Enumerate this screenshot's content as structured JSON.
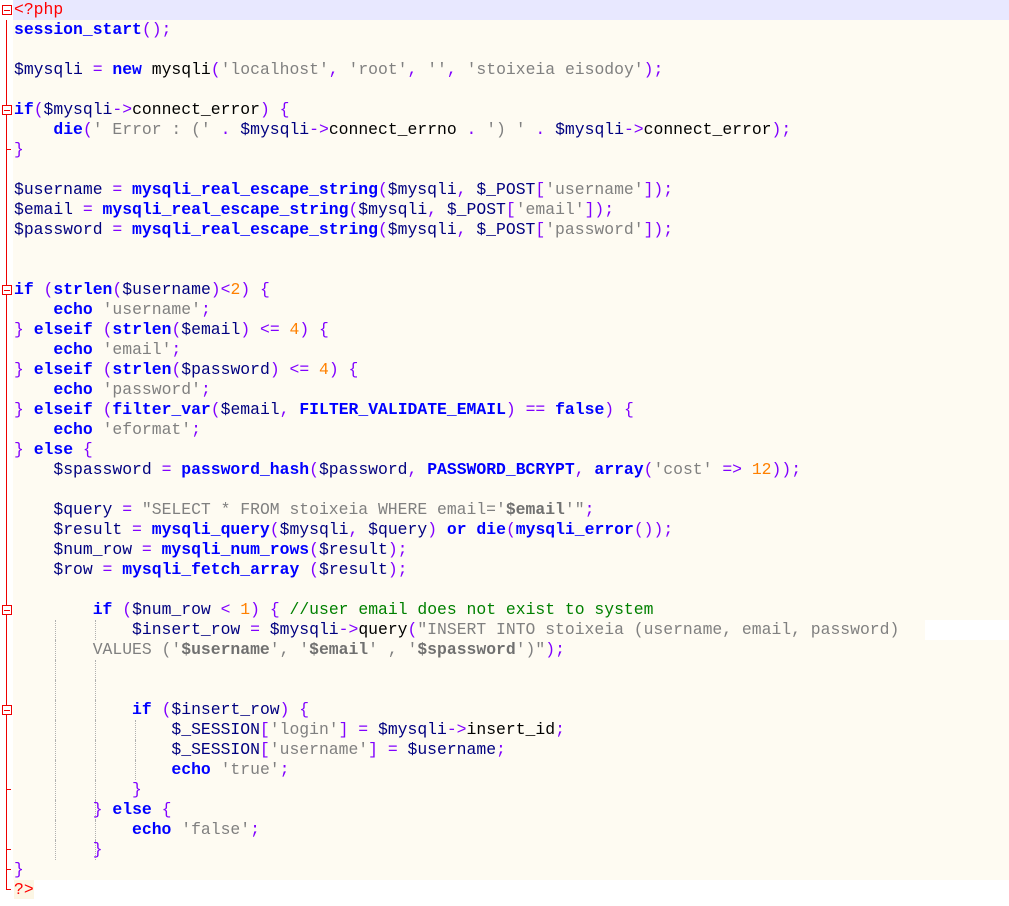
{
  "lines": [
    [
      [
        "p",
        "<?php"
      ]
    ],
    [
      [
        "k",
        "session_start"
      ],
      [
        "o",
        "();"
      ]
    ],
    [],
    [
      [
        "v",
        "$mysqli"
      ],
      [
        "o",
        " = "
      ],
      [
        "k",
        "new"
      ],
      [
        "t",
        " mysqli"
      ],
      [
        "o",
        "("
      ],
      [
        "s",
        "'localhost'"
      ],
      [
        "o",
        ", "
      ],
      [
        "s",
        "'root'"
      ],
      [
        "o",
        ", "
      ],
      [
        "s",
        "''"
      ],
      [
        "o",
        ", "
      ],
      [
        "s",
        "'stoixeia eisodoy'"
      ],
      [
        "o",
        ");"
      ]
    ],
    [],
    [
      [
        "k",
        "if"
      ],
      [
        "o",
        "("
      ],
      [
        "v",
        "$mysqli"
      ],
      [
        "o",
        "->"
      ],
      [
        "t",
        "connect_error"
      ],
      [
        "o",
        ") {"
      ]
    ],
    [
      [
        "t",
        "    "
      ],
      [
        "k",
        "die"
      ],
      [
        "o",
        "("
      ],
      [
        "s",
        "' Error : ('"
      ],
      [
        "o",
        " . "
      ],
      [
        "v",
        "$mysqli"
      ],
      [
        "o",
        "->"
      ],
      [
        "t",
        "connect_errno"
      ],
      [
        "o",
        " . "
      ],
      [
        "s",
        "') '"
      ],
      [
        "o",
        " . "
      ],
      [
        "v",
        "$mysqli"
      ],
      [
        "o",
        "->"
      ],
      [
        "t",
        "connect_error"
      ],
      [
        "o",
        ");"
      ]
    ],
    [
      [
        "o",
        "}"
      ]
    ],
    [],
    [
      [
        "v",
        "$username"
      ],
      [
        "o",
        " = "
      ],
      [
        "k",
        "mysqli_real_escape_string"
      ],
      [
        "o",
        "("
      ],
      [
        "v",
        "$mysqli"
      ],
      [
        "o",
        ", "
      ],
      [
        "v",
        "$_POST"
      ],
      [
        "o",
        "["
      ],
      [
        "s",
        "'username'"
      ],
      [
        "o",
        "]);"
      ]
    ],
    [
      [
        "v",
        "$email"
      ],
      [
        "o",
        " = "
      ],
      [
        "k",
        "mysqli_real_escape_string"
      ],
      [
        "o",
        "("
      ],
      [
        "v",
        "$mysqli"
      ],
      [
        "o",
        ", "
      ],
      [
        "v",
        "$_POST"
      ],
      [
        "o",
        "["
      ],
      [
        "s",
        "'email'"
      ],
      [
        "o",
        "]);"
      ]
    ],
    [
      [
        "v",
        "$password"
      ],
      [
        "o",
        " = "
      ],
      [
        "k",
        "mysqli_real_escape_string"
      ],
      [
        "o",
        "("
      ],
      [
        "v",
        "$mysqli"
      ],
      [
        "o",
        ", "
      ],
      [
        "v",
        "$_POST"
      ],
      [
        "o",
        "["
      ],
      [
        "s",
        "'password'"
      ],
      [
        "o",
        "]);"
      ]
    ],
    [],
    [],
    [
      [
        "k",
        "if"
      ],
      [
        "t",
        " "
      ],
      [
        "o",
        "("
      ],
      [
        "k",
        "strlen"
      ],
      [
        "o",
        "("
      ],
      [
        "v",
        "$username"
      ],
      [
        "o",
        ")<"
      ],
      [
        "n",
        "2"
      ],
      [
        "o",
        ") {"
      ]
    ],
    [
      [
        "t",
        "    "
      ],
      [
        "k",
        "echo"
      ],
      [
        "t",
        " "
      ],
      [
        "s",
        "'username'"
      ],
      [
        "o",
        ";"
      ]
    ],
    [
      [
        "o",
        "} "
      ],
      [
        "k",
        "elseif"
      ],
      [
        "t",
        " "
      ],
      [
        "o",
        "("
      ],
      [
        "k",
        "strlen"
      ],
      [
        "o",
        "("
      ],
      [
        "v",
        "$email"
      ],
      [
        "o",
        ") <= "
      ],
      [
        "n",
        "4"
      ],
      [
        "o",
        ") {"
      ]
    ],
    [
      [
        "t",
        "    "
      ],
      [
        "k",
        "echo"
      ],
      [
        "t",
        " "
      ],
      [
        "s",
        "'email'"
      ],
      [
        "o",
        ";"
      ]
    ],
    [
      [
        "o",
        "} "
      ],
      [
        "k",
        "elseif"
      ],
      [
        "t",
        " "
      ],
      [
        "o",
        "("
      ],
      [
        "k",
        "strlen"
      ],
      [
        "o",
        "("
      ],
      [
        "v",
        "$password"
      ],
      [
        "o",
        ") <= "
      ],
      [
        "n",
        "4"
      ],
      [
        "o",
        ") {"
      ]
    ],
    [
      [
        "t",
        "    "
      ],
      [
        "k",
        "echo"
      ],
      [
        "t",
        " "
      ],
      [
        "s",
        "'password'"
      ],
      [
        "o",
        ";"
      ]
    ],
    [
      [
        "o",
        "} "
      ],
      [
        "k",
        "elseif"
      ],
      [
        "t",
        " "
      ],
      [
        "o",
        "("
      ],
      [
        "k",
        "filter_var"
      ],
      [
        "o",
        "("
      ],
      [
        "v",
        "$email"
      ],
      [
        "o",
        ", "
      ],
      [
        "k",
        "FILTER_VALIDATE_EMAIL"
      ],
      [
        "o",
        ") == "
      ],
      [
        "k",
        "false"
      ],
      [
        "o",
        ") {"
      ]
    ],
    [
      [
        "t",
        "    "
      ],
      [
        "k",
        "echo"
      ],
      [
        "t",
        " "
      ],
      [
        "s",
        "'eformat'"
      ],
      [
        "o",
        ";"
      ]
    ],
    [
      [
        "o",
        "} "
      ],
      [
        "k",
        "else"
      ],
      [
        "o",
        " {"
      ]
    ],
    [
      [
        "t",
        "    "
      ],
      [
        "v",
        "$spassword"
      ],
      [
        "o",
        " = "
      ],
      [
        "k",
        "password_hash"
      ],
      [
        "o",
        "("
      ],
      [
        "v",
        "$password"
      ],
      [
        "o",
        ", "
      ],
      [
        "k",
        "PASSWORD_BCRYPT"
      ],
      [
        "o",
        ", "
      ],
      [
        "k",
        "array"
      ],
      [
        "o",
        "("
      ],
      [
        "s",
        "'cost'"
      ],
      [
        "o",
        " => "
      ],
      [
        "n",
        "12"
      ],
      [
        "o",
        "));"
      ]
    ],
    [],
    [
      [
        "t",
        "    "
      ],
      [
        "v",
        "$query"
      ],
      [
        "o",
        " = "
      ],
      [
        "s",
        "\"SELECT * FROM stoixeia WHERE email='"
      ],
      [
        "sv",
        "$email"
      ],
      [
        "s",
        "'\""
      ],
      [
        "o",
        ";"
      ]
    ],
    [
      [
        "t",
        "    "
      ],
      [
        "v",
        "$result"
      ],
      [
        "o",
        " = "
      ],
      [
        "k",
        "mysqli_query"
      ],
      [
        "o",
        "("
      ],
      [
        "v",
        "$mysqli"
      ],
      [
        "o",
        ", "
      ],
      [
        "v",
        "$query"
      ],
      [
        "o",
        ") "
      ],
      [
        "k",
        "or"
      ],
      [
        "t",
        " "
      ],
      [
        "k",
        "die"
      ],
      [
        "o",
        "("
      ],
      [
        "k",
        "mysqli_error"
      ],
      [
        "o",
        "());"
      ]
    ],
    [
      [
        "t",
        "    "
      ],
      [
        "v",
        "$num_row"
      ],
      [
        "o",
        " = "
      ],
      [
        "k",
        "mysqli_num_rows"
      ],
      [
        "o",
        "("
      ],
      [
        "v",
        "$result"
      ],
      [
        "o",
        ");"
      ]
    ],
    [
      [
        "t",
        "    "
      ],
      [
        "v",
        "$row"
      ],
      [
        "o",
        " = "
      ],
      [
        "k",
        "mysqli_fetch_array"
      ],
      [
        "t",
        " "
      ],
      [
        "o",
        "("
      ],
      [
        "v",
        "$result"
      ],
      [
        "o",
        ");"
      ]
    ],
    [],
    [
      [
        "t",
        "        "
      ],
      [
        "k",
        "if"
      ],
      [
        "t",
        " "
      ],
      [
        "o",
        "("
      ],
      [
        "v",
        "$num_row"
      ],
      [
        "o",
        " < "
      ],
      [
        "n",
        "1"
      ],
      [
        "o",
        ") { "
      ],
      [
        "c",
        "//user email does not exist to system"
      ]
    ],
    [
      [
        "t",
        "            "
      ],
      [
        "v",
        "$insert_row"
      ],
      [
        "o",
        " = "
      ],
      [
        "v",
        "$mysqli"
      ],
      [
        "o",
        "->"
      ],
      [
        "t",
        "query"
      ],
      [
        "o",
        "("
      ],
      [
        "s",
        "\"INSERT INTO stoixeia (username, email, password)"
      ]
    ],
    [
      [
        "t",
        "        "
      ],
      [
        "s",
        "VALUES ('"
      ],
      [
        "sv",
        "$username"
      ],
      [
        "s",
        "', '"
      ],
      [
        "sv",
        "$email"
      ],
      [
        "s",
        "' , '"
      ],
      [
        "sv",
        "$spassword"
      ],
      [
        "s",
        "')\""
      ],
      [
        "o",
        ");"
      ]
    ],
    [],
    [],
    [
      [
        "t",
        "            "
      ],
      [
        "k",
        "if"
      ],
      [
        "t",
        " "
      ],
      [
        "o",
        "("
      ],
      [
        "v",
        "$insert_row"
      ],
      [
        "o",
        ") {"
      ]
    ],
    [
      [
        "t",
        "                "
      ],
      [
        "v",
        "$_SESSION"
      ],
      [
        "o",
        "["
      ],
      [
        "s",
        "'login'"
      ],
      [
        "o",
        "] = "
      ],
      [
        "v",
        "$mysqli"
      ],
      [
        "o",
        "->"
      ],
      [
        "t",
        "insert_id"
      ],
      [
        "o",
        ";"
      ]
    ],
    [
      [
        "t",
        "                "
      ],
      [
        "v",
        "$_SESSION"
      ],
      [
        "o",
        "["
      ],
      [
        "s",
        "'username'"
      ],
      [
        "o",
        "] = "
      ],
      [
        "v",
        "$username"
      ],
      [
        "o",
        ";"
      ]
    ],
    [
      [
        "t",
        "                "
      ],
      [
        "k",
        "echo"
      ],
      [
        "t",
        " "
      ],
      [
        "s",
        "'true'"
      ],
      [
        "o",
        ";"
      ]
    ],
    [
      [
        "t",
        "            "
      ],
      [
        "o",
        "}"
      ]
    ],
    [
      [
        "t",
        "        "
      ],
      [
        "o",
        "} "
      ],
      [
        "k",
        "else"
      ],
      [
        "o",
        " {"
      ]
    ],
    [
      [
        "t",
        "            "
      ],
      [
        "k",
        "echo"
      ],
      [
        "t",
        " "
      ],
      [
        "s",
        "'false'"
      ],
      [
        "o",
        ";"
      ]
    ],
    [
      [
        "t",
        "        "
      ],
      [
        "o",
        "}"
      ]
    ],
    [
      [
        "o",
        "}"
      ]
    ],
    [
      [
        "p",
        "?>"
      ]
    ]
  ]
}
